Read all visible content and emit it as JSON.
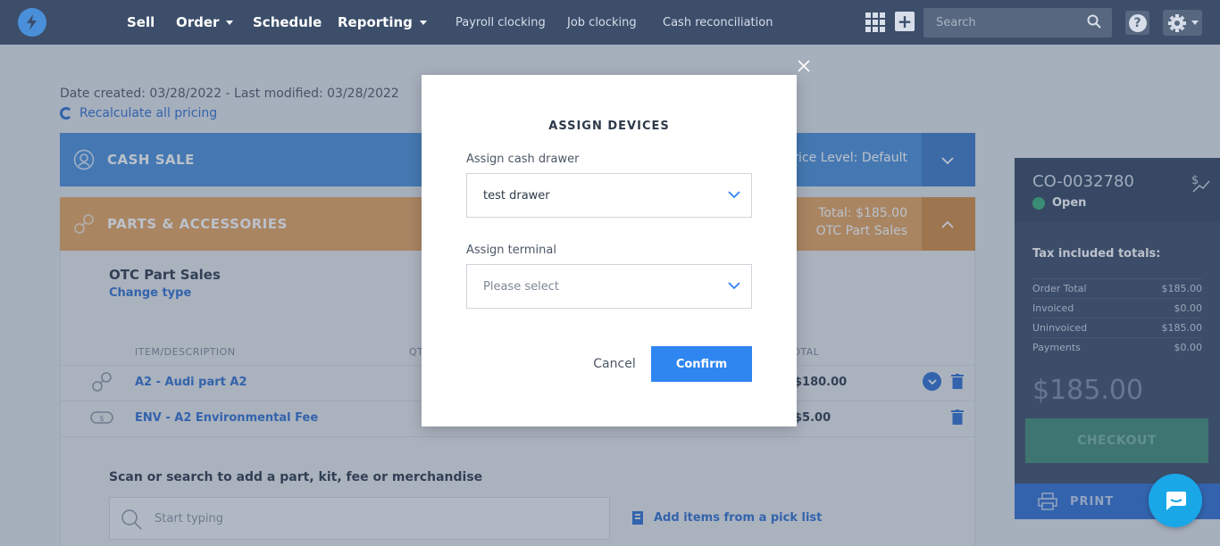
{
  "nav": {
    "main": [
      {
        "label": "Sell",
        "dropdown": false
      },
      {
        "label": "Order",
        "dropdown": true
      },
      {
        "label": "Schedule",
        "dropdown": false
      },
      {
        "label": "Reporting",
        "dropdown": true
      }
    ],
    "sub": [
      "Payroll clocking",
      "Job clocking",
      "Cash reconciliation"
    ],
    "search_placeholder": "Search",
    "help_label": "?"
  },
  "page": {
    "meta": "Date created: 03/28/2022 - Last modified: 03/28/2022",
    "recalculate": "Recalculate all pricing",
    "cash_sale": {
      "title": "CASH SALE",
      "price_level": "Price Level: Default"
    },
    "parts": {
      "title": "PARTS & ACCESSORIES",
      "total": "Total: $185.00",
      "subtitle": "OTC Part Sales"
    },
    "sale_type": "OTC Part Sales",
    "change_type": "Change type",
    "columns": {
      "item": "ITEM/DESCRIPTION",
      "qty": "QT",
      "total": "TOTAL"
    },
    "rows": [
      {
        "desc": "A2 - Audi part A2",
        "amount": "$180.00"
      },
      {
        "desc": "ENV - A2 Environmental Fee",
        "amount": "$5.00"
      }
    ],
    "scan_label": "Scan or search to add a part, kit, fee or merchandise",
    "scan_placeholder": "Start typing",
    "pick_list": "Add items from a pick list"
  },
  "summary": {
    "order_id": "CO-0032780",
    "status": "Open",
    "tax_heading": "Tax included totals:",
    "rows": [
      {
        "label": "Order Total",
        "value": "$185.00"
      },
      {
        "label": "Invoiced",
        "value": "$0.00"
      },
      {
        "label": "Uninvoiced",
        "value": "$185.00"
      },
      {
        "label": "Payments",
        "value": "$0.00"
      }
    ],
    "total": "$185.00",
    "checkout": "CHECKOUT",
    "print": "PRINT"
  },
  "modal": {
    "title": "ASSIGN DEVICES",
    "cash_drawer_label": "Assign cash drawer",
    "cash_drawer_value": "test drawer",
    "terminal_label": "Assign terminal",
    "terminal_placeholder": "Please select",
    "cancel": "Cancel",
    "confirm": "Confirm"
  },
  "colors": {
    "nav_bg": "#3c4e6a",
    "cash_sale_band": "#4a8fd9",
    "parts_band": "#e4a45f",
    "accent": "#2f86f0",
    "checkout": "#3f8a73",
    "status_open": "#39b07a"
  }
}
